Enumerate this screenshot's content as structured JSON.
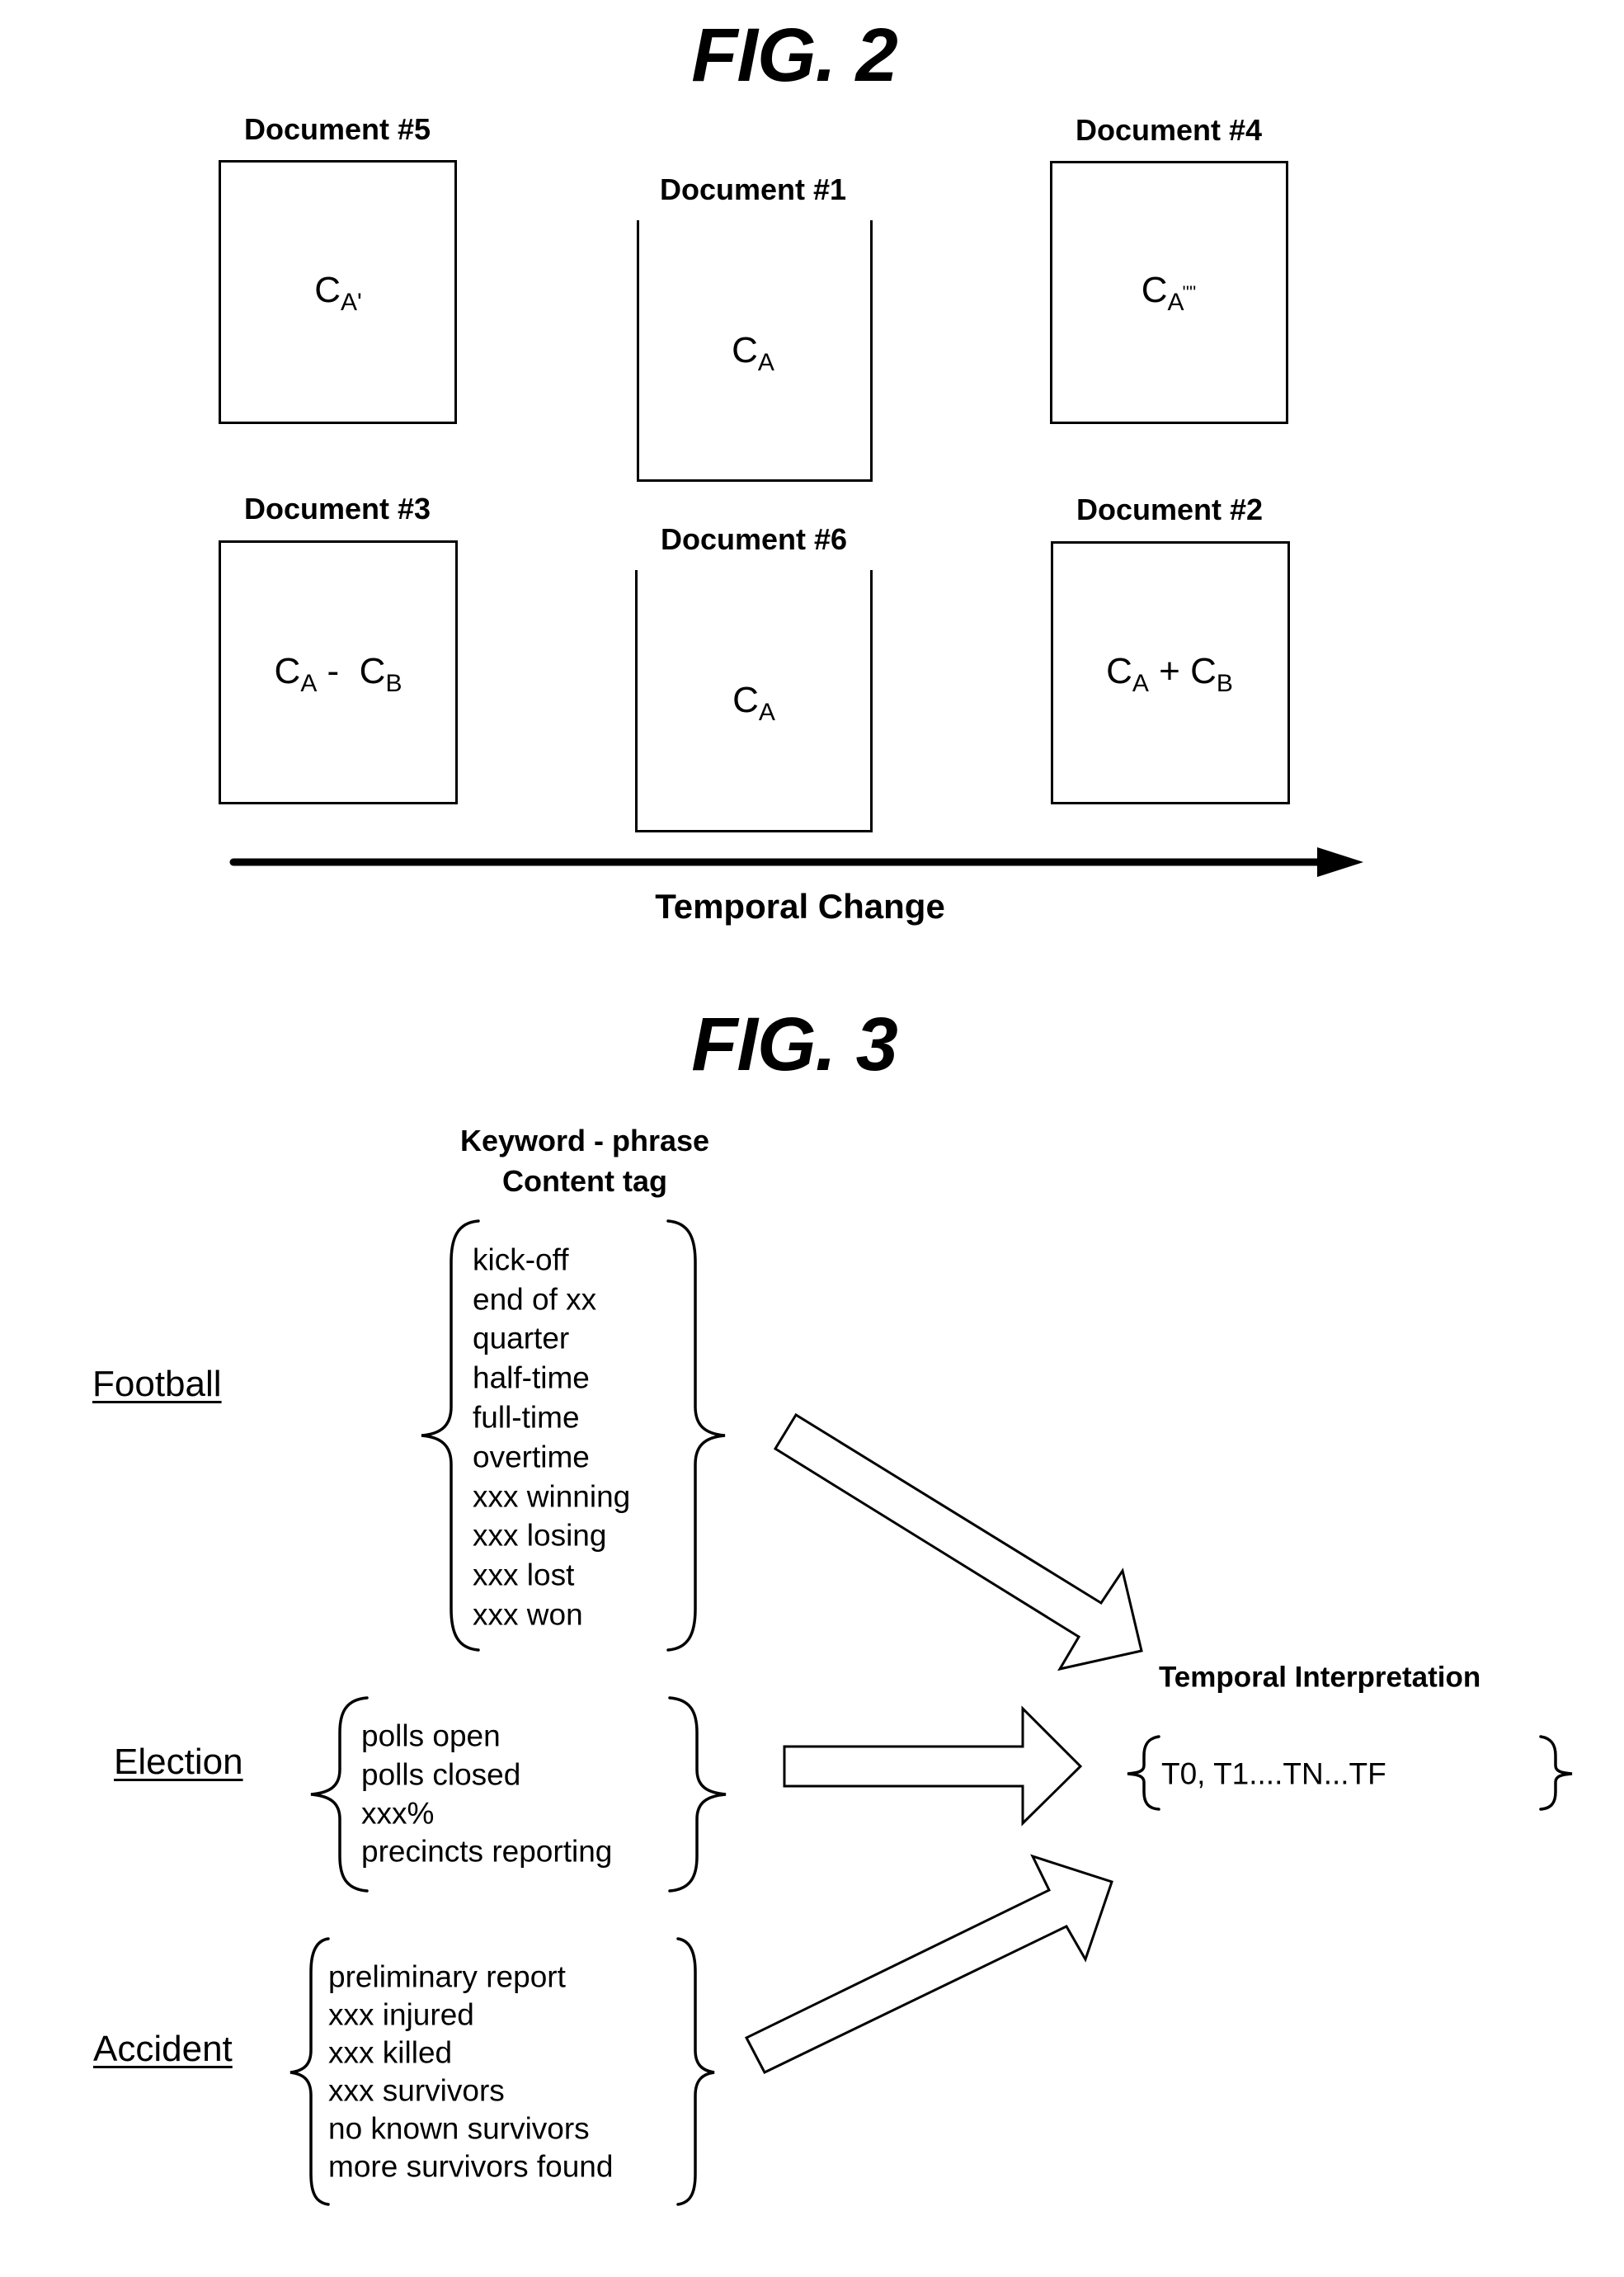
{
  "fig2": {
    "title": "FIG. 2",
    "documents": [
      {
        "label": "Document #5",
        "content_main": "C",
        "content_sub": "A'",
        "content_sup": ""
      },
      {
        "label": "Document #1",
        "content_main": "C",
        "content_sub": "A",
        "content_sup": ""
      },
      {
        "label": "Document #4",
        "content_main": "C",
        "content_sub": "A",
        "content_sup": "''''"
      },
      {
        "label": "Document #3",
        "expression": [
          {
            "main": "C",
            "sub": "A"
          },
          {
            "op": " -  "
          },
          {
            "main": "C",
            "sub": "B"
          }
        ]
      },
      {
        "label": "Document #6",
        "content_main": "C",
        "content_sub": "A",
        "content_sup": ""
      },
      {
        "label": "Document #2",
        "expression": [
          {
            "main": "C",
            "sub": "A"
          },
          {
            "op": " + "
          },
          {
            "main": "C",
            "sub": "B"
          }
        ]
      }
    ],
    "axis_label": "Temporal Change"
  },
  "fig3": {
    "title": "FIG. 3",
    "column_header": [
      "Keyword - phrase",
      "Content tag"
    ],
    "categories": [
      {
        "label": "Football",
        "keywords": [
          "kick-off",
          "end of xx",
          "quarter",
          "half-time",
          "full-time",
          "overtime",
          "xxx winning",
          "xxx losing",
          "xxx lost",
          "xxx won"
        ]
      },
      {
        "label": "Election",
        "keywords": [
          "polls open",
          "polls closed",
          "xxx%",
          "precincts reporting"
        ]
      },
      {
        "label": "Accident",
        "keywords": [
          "preliminary report",
          "xxx injured",
          "xxx killed",
          "xxx survivors",
          "no known survivors",
          "more survivors found"
        ]
      }
    ],
    "output": {
      "title": "Temporal Interpretation",
      "sequence": "T0, T1....TN...TF"
    }
  }
}
